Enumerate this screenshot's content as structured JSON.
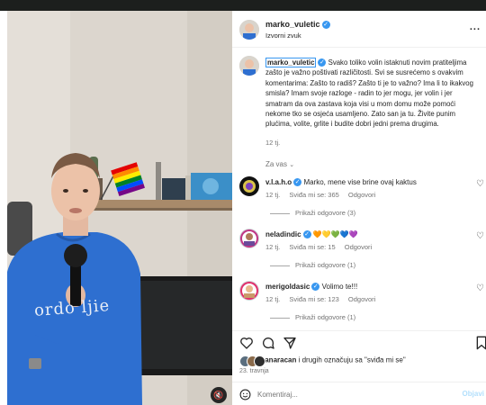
{
  "post": {
    "username": "marko_vuletic",
    "audio": "Izvorni zvuk",
    "more": "...",
    "caption": "Svako toliko volin istaknuti novim pratiteljima zašto je važno poštivati različitosti. Svi se susrećemo s ovakvim komentarima: Zašto to radiš? Zašto ti je to važno? Ima li to ikakvog smisla? Imam svoje razloge - radin to jer mogu, jer volin i jer smatram da ova zastava koja visi u mom domu može pomoći nekome tko se osjeća usamljeno. Zato san ja tu. Živite punim plućima, volite, grlite i budite dobri jedni prema drugima.",
    "caption_time": "12 tj.",
    "see_translation": "Za vas",
    "shirt_text": "ordo ljie"
  },
  "comments": [
    {
      "user": "v.l.a.h.o",
      "text": "Marko, mene vise brine ovaj kaktus",
      "time": "12 tj.",
      "likes": "Sviđa mi se: 365",
      "reply": "Odgovori",
      "view_replies": "Prikaži odgovore (3)"
    },
    {
      "user": "neladindic",
      "text": "🧡💛💚💙💜",
      "time": "12 tj.",
      "likes": "Sviđa mi se: 15",
      "reply": "Odgovori",
      "view_replies": "Prikaži odgovore (1)"
    },
    {
      "user": "merigoldasic",
      "text": "Volimo te!!!",
      "time": "12 tj.",
      "likes": "Sviđa mi se: 123",
      "reply": "Odgovori",
      "view_replies": "Prikaži odgovore (1)"
    }
  ],
  "actions": {
    "liked_by_user": "anaracan",
    "liked_by_rest": "i drugih označuju sa \"sviđa mi se\"",
    "date": "23. travnja"
  },
  "composer": {
    "placeholder": "Komentiraj...",
    "post_label": "Objavi"
  },
  "colors": {
    "accent": "#3897f0",
    "muted": "#737373"
  }
}
